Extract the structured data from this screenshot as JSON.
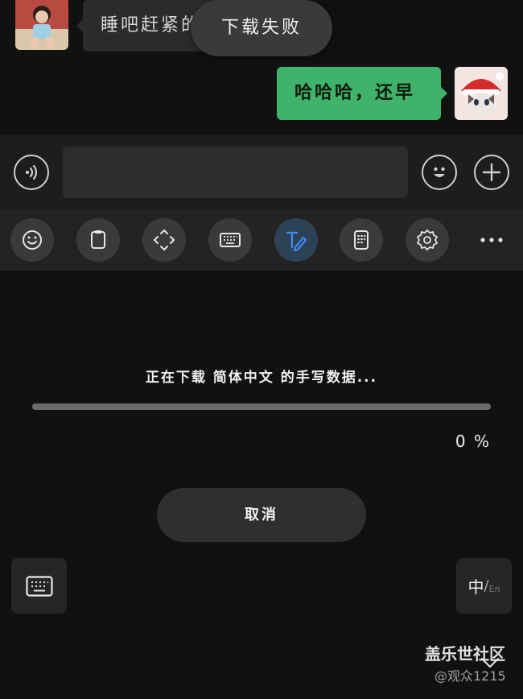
{
  "chat": {
    "incoming_message": "睡吧赶紧的",
    "outgoing_message": "哈哈哈，还早",
    "toast": "下载失败"
  },
  "keyboard_toolbar": {
    "items": [
      {
        "icon": "emoji-icon"
      },
      {
        "icon": "clipboard-icon"
      },
      {
        "icon": "cursor-move-icon"
      },
      {
        "icon": "keyboard-icon"
      },
      {
        "icon": "handwriting-icon",
        "active": true
      },
      {
        "icon": "numpad-icon"
      },
      {
        "icon": "settings-gear-icon"
      },
      {
        "icon": "more-dots-icon"
      }
    ],
    "active_color": "#3f8cff"
  },
  "download": {
    "status_text": "正在下载 简体中文 的手写数据...",
    "progress_percent": 0,
    "percent_label": "0 %",
    "cancel_label": "取消"
  },
  "lang_switch": {
    "main": "中",
    "slash": "/",
    "sub": "En"
  },
  "watermark": {
    "title": "盖乐世社区",
    "user": "@观众1215"
  },
  "colors": {
    "outgoing_bubble": "#3fb36a",
    "background": "#111111"
  }
}
